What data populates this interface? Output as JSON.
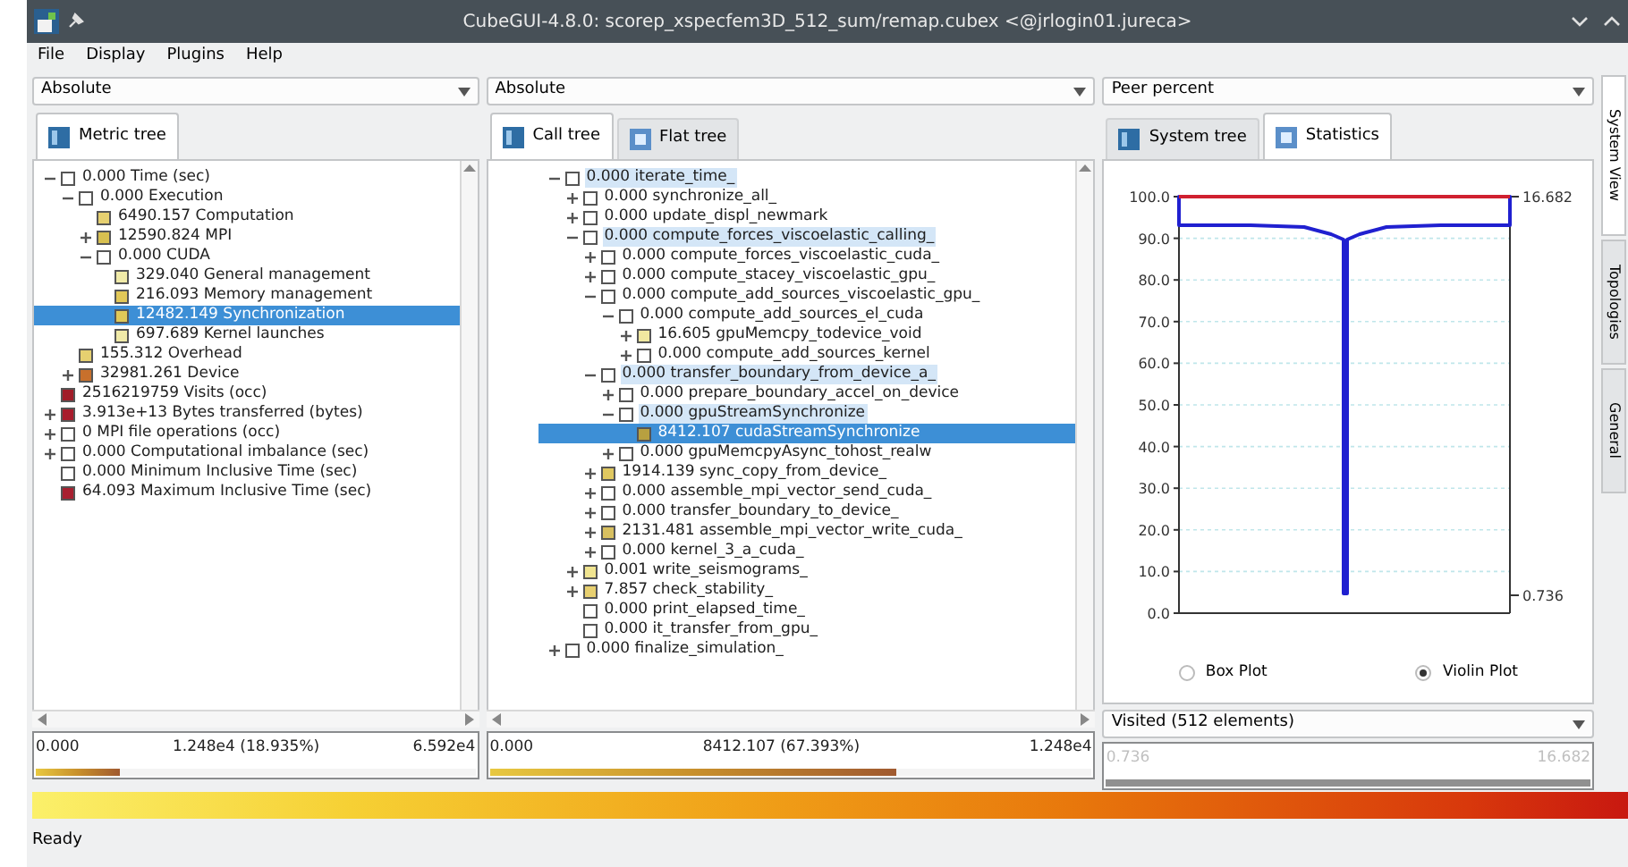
{
  "window": {
    "title": "CubeGUI-4.8.0: scorep_xspecfem3D_512_sum/remap.cubex <@jrlogin01.jureca>"
  },
  "menu": [
    "File",
    "Display",
    "Plugins",
    "Help"
  ],
  "panels": [
    {
      "mode": "Absolute",
      "tabs": [
        {
          "label": "Metric tree",
          "selected": true
        }
      ],
      "tree": [
        {
          "text": "0.000 Time (sec)",
          "color": "#ffffff",
          "expanded": true,
          "selected": false,
          "children": [
            {
              "text": "0.000 Execution",
              "color": "#ffffff",
              "expanded": true,
              "selected": false,
              "children": [
                {
                  "text": "6490.157 Computation",
                  "color": "#e6d070",
                  "selected": false
                },
                {
                  "text": "12590.824 MPI",
                  "color": "#d8c050",
                  "expanded": false,
                  "selected": false
                },
                {
                  "text": "0.000 CUDA",
                  "color": "#ffffff",
                  "expanded": true,
                  "selected": false,
                  "children": [
                    {
                      "text": "329.040 General management",
                      "color": "#f0eaa8",
                      "selected": false
                    },
                    {
                      "text": "216.093 Memory management",
                      "color": "#e2c858",
                      "selected": false
                    },
                    {
                      "text": "12482.149 Synchronization",
                      "color": "#e0c858",
                      "selected": true
                    },
                    {
                      "text": "697.689 Kernel launches",
                      "color": "#f0eaa8",
                      "selected": false
                    }
                  ]
                }
              ]
            },
            {
              "text": "155.312 Overhead",
              "color": "#e6d070",
              "selected": false
            },
            {
              "text": "32981.261 Device",
              "color": "#c8702c",
              "expanded": false,
              "selected": false
            }
          ]
        },
        {
          "text": "2516219759 Visits (occ)",
          "color": "#a01c28",
          "selected": false
        },
        {
          "text": "3.913e+13 Bytes transferred (bytes)",
          "color": "#a81c2c",
          "expanded": false,
          "selected": false
        },
        {
          "text": "0 MPI file operations (occ)",
          "color": "#ffffff",
          "expanded": false,
          "selected": false
        },
        {
          "text": "0.000 Computational imbalance (sec)",
          "color": "#ffffff",
          "expanded": false,
          "selected": false
        },
        {
          "text": "0.000 Minimum Inclusive Time (sec)",
          "color": "#ffffff",
          "selected": false
        },
        {
          "text": "64.093 Maximum Inclusive Time (sec)",
          "color": "#a82030",
          "selected": false
        }
      ],
      "value_bar": {
        "min": "0.000",
        "value": "1.248e4 (18.935%)",
        "max": "6.592e4",
        "level": 0.19
      }
    },
    {
      "mode": "Absolute",
      "tabs": [
        {
          "label": "Call tree",
          "selected": true
        },
        {
          "label": "Flat tree",
          "selected": false
        }
      ],
      "tree": [
        {
          "text": "0.000 iterate_time_",
          "color": "#ffffff",
          "expanded": true,
          "selected": false,
          "highlighted": true,
          "children": [
            {
              "text": "0.000 synchronize_all_",
              "color": "#ffffff",
              "expanded": false,
              "selected": false,
              "highlighted": false
            },
            {
              "text": "0.000 update_displ_newmark",
              "color": "#ffffff",
              "expanded": false,
              "selected": false,
              "highlighted": false
            },
            {
              "text": "0.000 compute_forces_viscoelastic_calling_",
              "color": "#ffffff",
              "expanded": true,
              "selected": false,
              "highlighted": true,
              "children": [
                {
                  "text": "0.000 compute_forces_viscoelastic_cuda_",
                  "color": "#ffffff",
                  "expanded": false,
                  "selected": false,
                  "highlighted": false
                },
                {
                  "text": "0.000 compute_stacey_viscoelastic_gpu_",
                  "color": "#ffffff",
                  "expanded": false,
                  "selected": false,
                  "highlighted": false
                },
                {
                  "text": "0.000 compute_add_sources_viscoelastic_gpu_",
                  "color": "#ffffff",
                  "expanded": true,
                  "selected": false,
                  "highlighted": false,
                  "children": [
                    {
                      "text": "0.000 compute_add_sources_el_cuda",
                      "color": "#ffffff",
                      "expanded": true,
                      "selected": false,
                      "highlighted": false,
                      "children": [
                        {
                          "text": "16.605 gpuMemcpy_todevice_void",
                          "color": "#f0e8a0",
                          "expanded": false,
                          "selected": false,
                          "highlighted": false
                        },
                        {
                          "text": "0.000 compute_add_sources_kernel",
                          "color": "#ffffff",
                          "expanded": false,
                          "selected": false,
                          "highlighted": false
                        }
                      ]
                    }
                  ]
                },
                {
                  "text": "0.000 transfer_boundary_from_device_a_",
                  "color": "#ffffff",
                  "expanded": true,
                  "selected": false,
                  "highlighted": true,
                  "children": [
                    {
                      "text": "0.000 prepare_boundary_accel_on_device",
                      "color": "#ffffff",
                      "expanded": false,
                      "selected": false,
                      "highlighted": false
                    },
                    {
                      "text": "0.000 gpuStreamSynchronize",
                      "color": "#ffffff",
                      "expanded": true,
                      "selected": false,
                      "highlighted": true,
                      "children": [
                        {
                          "text": "8412.107 cudaStreamSynchronize",
                          "color": "#b8a040",
                          "selected": true,
                          "highlighted": false
                        }
                      ]
                    },
                    {
                      "text": "0.000 gpuMemcpyAsync_tohost_realw",
                      "color": "#ffffff",
                      "expanded": false,
                      "selected": false,
                      "highlighted": false
                    }
                  ]
                },
                {
                  "text": "1914.139 sync_copy_from_device_",
                  "color": "#e0c860",
                  "expanded": false,
                  "selected": false,
                  "highlighted": false
                },
                {
                  "text": "0.000 assemble_mpi_vector_send_cuda_",
                  "color": "#ffffff",
                  "expanded": false,
                  "selected": false,
                  "highlighted": false
                },
                {
                  "text": "0.000 transfer_boundary_to_device_",
                  "color": "#ffffff",
                  "expanded": false,
                  "selected": false,
                  "highlighted": false
                },
                {
                  "text": "2131.481 assemble_mpi_vector_write_cuda_",
                  "color": "#d8c060",
                  "expanded": false,
                  "selected": false,
                  "highlighted": false
                },
                {
                  "text": "0.000 kernel_3_a_cuda_",
                  "color": "#ffffff",
                  "expanded": false,
                  "selected": false,
                  "highlighted": false
                }
              ]
            },
            {
              "text": "0.001 write_seismograms_",
              "color": "#f0e490",
              "expanded": false,
              "selected": false,
              "highlighted": false
            },
            {
              "text": "7.857 check_stability_",
              "color": "#e8d070",
              "expanded": false,
              "selected": false,
              "highlighted": false
            },
            {
              "text": "0.000 print_elapsed_time_",
              "color": "#ffffff",
              "selected": false,
              "highlighted": false
            },
            {
              "text": "0.000 it_transfer_from_gpu_",
              "color": "#ffffff",
              "selected": false,
              "highlighted": false
            }
          ]
        },
        {
          "text": "0.000 finalize_simulation_",
          "color": "#ffffff",
          "expanded": false,
          "selected": false,
          "highlighted": false
        }
      ],
      "value_bar": {
        "min": "0.000",
        "value": "8412.107 (67.393%)",
        "max": "1.248e4",
        "level": 0.674
      }
    }
  ],
  "system_panel": {
    "mode": "Peer percent",
    "tabs": [
      {
        "label": "System tree",
        "selected": false
      },
      {
        "label": "Statistics",
        "selected": true
      }
    ],
    "plot": {
      "yticks": [
        "100.0",
        "90.0",
        "80.0",
        "70.0",
        "60.0",
        "50.0",
        "40.0",
        "30.0",
        "20.0",
        "10.0",
        "0.0"
      ],
      "max_label": "16.682",
      "min_label": "0.736"
    },
    "options": [
      {
        "label": "Box Plot",
        "selected": false
      },
      {
        "label": "Violin Plot",
        "selected": true
      }
    ],
    "filter": "Visited (512 elements)",
    "value_bar": {
      "min": "0.736",
      "max": "16.682",
      "disabled": true
    }
  },
  "side_tabs": [
    {
      "label": "System View",
      "selected": true
    },
    {
      "label": "Topologies",
      "selected": false
    },
    {
      "label": "General",
      "selected": false
    }
  ],
  "status_bar": "Ready"
}
